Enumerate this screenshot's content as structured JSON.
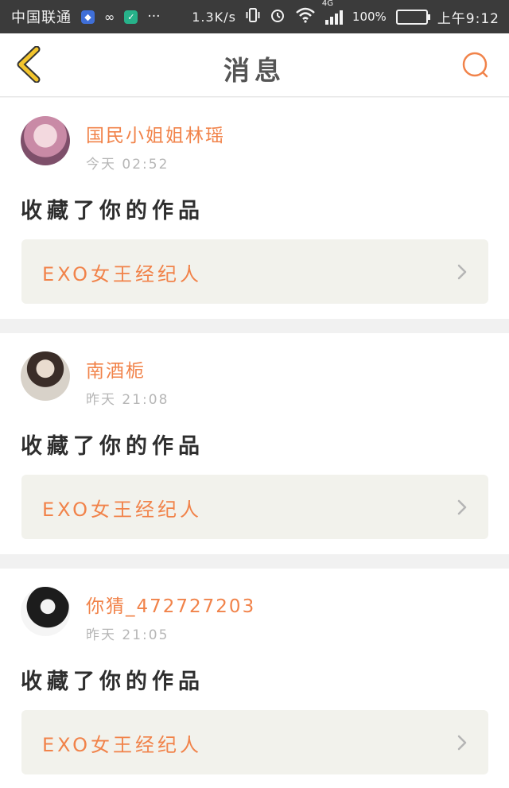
{
  "status_bar": {
    "carrier": "中国联通",
    "more": "···",
    "net_speed": "1.3K/s",
    "network": "4G",
    "battery": "100%",
    "time": "上午9:12"
  },
  "nav": {
    "title": "消息"
  },
  "colors": {
    "accent": "#f1834a",
    "back_arrow": "#f3c52d",
    "card_bg": "#f2f2ec"
  },
  "messages": [
    {
      "user": "国民小姐姐林瑶",
      "time": "今天 02:52",
      "action": "收藏了你的作品",
      "work": "EXO女王经纪人"
    },
    {
      "user": "南酒栀",
      "time": "昨天 21:08",
      "action": "收藏了你的作品",
      "work": "EXO女王经纪人"
    },
    {
      "user": "你猜_472727203",
      "time": "昨天 21:05",
      "action": "收藏了你的作品",
      "work": "EXO女王经纪人"
    }
  ]
}
